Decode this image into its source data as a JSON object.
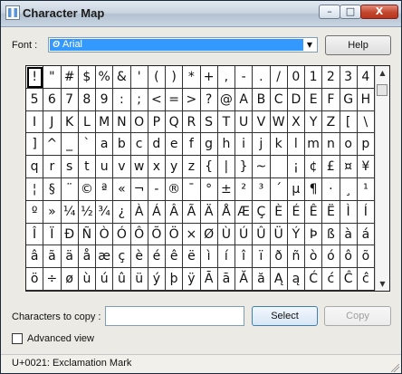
{
  "window": {
    "title": "Character Map",
    "controls": {
      "minimize": "–",
      "maximize": "□",
      "close": "X"
    }
  },
  "font": {
    "label": "Font :",
    "selected": "Arial",
    "icon": "font-icon",
    "arrow": "▼"
  },
  "help_button": "Help",
  "character_grid": {
    "selected_index": 0,
    "rows": [
      [
        "!",
        "\"",
        "#",
        "$",
        "%",
        "&",
        "'",
        "(",
        ")",
        "*",
        "+",
        ",",
        "-",
        ".",
        "/",
        "0",
        "1",
        "2",
        "3",
        "4"
      ],
      [
        "5",
        "6",
        "7",
        "8",
        "9",
        ":",
        ";",
        "<",
        "=",
        ">",
        "?",
        "@",
        "A",
        "B",
        "C",
        "D",
        "E",
        "F",
        "G",
        "H"
      ],
      [
        "I",
        "J",
        "K",
        "L",
        "M",
        "N",
        "O",
        "P",
        "Q",
        "R",
        "S",
        "T",
        "U",
        "V",
        "W",
        "X",
        "Y",
        "Z",
        "[",
        "\\"
      ],
      [
        "]",
        "^",
        "_",
        "`",
        "a",
        "b",
        "c",
        "d",
        "e",
        "f",
        "g",
        "h",
        "i",
        "j",
        "k",
        "l",
        "m",
        "n",
        "o",
        "p"
      ],
      [
        "q",
        "r",
        "s",
        "t",
        "u",
        "v",
        "w",
        "x",
        "y",
        "z",
        "{",
        "|",
        "}",
        "~",
        "",
        "¡",
        "¢",
        "£",
        "¤",
        "¥"
      ],
      [
        "¦",
        "§",
        "¨",
        "©",
        "ª",
        "«",
        "¬",
        "-",
        "®",
        "¯",
        "°",
        "±",
        "²",
        "³",
        "´",
        "µ",
        "¶",
        "·",
        "¸",
        "¹"
      ],
      [
        "º",
        "»",
        "¼",
        "½",
        "¾",
        "¿",
        "À",
        "Á",
        "Â",
        "Ã",
        "Ä",
        "Å",
        "Æ",
        "Ç",
        "È",
        "É",
        "Ê",
        "Ë",
        "Ì",
        "Í"
      ],
      [
        "Î",
        "Ï",
        "Ð",
        "Ñ",
        "Ò",
        "Ó",
        "Ô",
        "Õ",
        "Ö",
        "×",
        "Ø",
        "Ù",
        "Ú",
        "Û",
        "Ü",
        "Ý",
        "Þ",
        "ß",
        "à",
        "á"
      ],
      [
        "â",
        "ã",
        "ä",
        "å",
        "æ",
        "ç",
        "è",
        "é",
        "ê",
        "ë",
        "ì",
        "í",
        "î",
        "ï",
        "ð",
        "ñ",
        "ò",
        "ó",
        "ô",
        "õ"
      ],
      [
        "ö",
        "÷",
        "ø",
        "ù",
        "ú",
        "û",
        "ü",
        "ý",
        "þ",
        "ÿ",
        "Ā",
        "ā",
        "Ă",
        "ă",
        "Ą",
        "ą",
        "Ć",
        "ć",
        "Ĉ",
        "ĉ"
      ]
    ]
  },
  "scrollbar": {
    "up": "▲",
    "down": "▼"
  },
  "copy": {
    "label": "Characters to copy :",
    "value": "",
    "select_button": "Select",
    "copy_button": "Copy"
  },
  "advanced_view": {
    "label": "Advanced view",
    "checked": false
  },
  "status": "U+0021: Exclamation Mark"
}
